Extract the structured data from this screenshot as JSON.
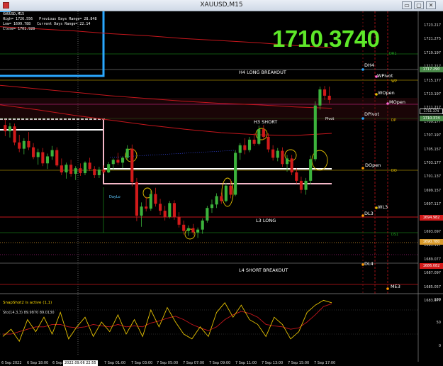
{
  "window": {
    "title": "XAUUSD,M15",
    "buttons": [
      "▭",
      "▢",
      "✕"
    ]
  },
  "info": {
    "line1": "XAUUSD,M15",
    "line2": "High= 1726.556   Previous Days Range= 28.848",
    "line3": "Low= 1699.788   Current Days Range= 22.14",
    "line4": "Close= 1701.928"
  },
  "big_price": "1710.3740",
  "colors": {
    "bg": "#000000",
    "up_candle": "#3cb33c",
    "down_candle": "#d11a1a",
    "big_price": "#5ee829",
    "bid_tag": "#4a8a4a",
    "ask_tag": "#d11a1a"
  },
  "levels": [
    {
      "name": "DR1",
      "text": "DR1",
      "color": "#1fa51f"
    },
    {
      "name": "DH4",
      "text": "DH4",
      "color": "#ffffff"
    },
    {
      "name": "H4 LONG BREAKOUT",
      "text": "H4 LONG BREAKOUT",
      "color": "#ffffff"
    },
    {
      "name": "WPivot",
      "text": "WPivot",
      "color": "#ffffff"
    },
    {
      "name": "WP",
      "text": "WP",
      "color": "#e6c200"
    },
    {
      "name": "WOpen",
      "text": "WOpen",
      "color": "#ffffff"
    },
    {
      "name": "MOpen",
      "text": "MOpen",
      "color": "#ffffff"
    },
    {
      "name": "DPivot",
      "text": "DPivot",
      "color": "#ffffff"
    },
    {
      "name": "H3 SHORT",
      "text": "H3 SHORT",
      "color": "#ffffff"
    },
    {
      "name": "Pivot",
      "text": "Pivot",
      "color": "#ffffff"
    },
    {
      "name": "DP",
      "text": "DP",
      "color": "#e6c200"
    },
    {
      "name": "DOpen",
      "text": "DOpen",
      "color": "#ffffff"
    },
    {
      "name": "DO",
      "text": "DO",
      "color": "#e6c200"
    },
    {
      "name": "WL3",
      "text": "WL3",
      "color": "#ffffff"
    },
    {
      "name": "DL3",
      "text": "DL3",
      "color": "#ffffff"
    },
    {
      "name": "L3 LONG",
      "text": "L3 LONG",
      "color": "#ffffff"
    },
    {
      "name": "DS1",
      "text": "DS1",
      "color": "#1fa51f"
    },
    {
      "name": "DL4",
      "text": "DL4",
      "color": "#ffffff"
    },
    {
      "name": "L4 SHORT BREAKOUT",
      "text": "L4 SHORT BREAKOUT",
      "color": "#ffffff"
    },
    {
      "name": "ME3",
      "text": "ME3",
      "color": "#ffffff"
    }
  ],
  "day_lo_label": "DayLo",
  "price_axis": [
    "1723.217",
    "1721.275",
    "1719.197",
    "1717.217",
    "1715.177",
    "1713.197",
    "1711.217",
    "1709.177",
    "1707.197",
    "1705.157",
    "1703.177",
    "1701.137",
    "1699.157",
    "1697.117",
    "1695.137",
    "1693.097",
    "1691.117",
    "1689.077",
    "1687.097",
    "1685.057",
    "1683.077"
  ],
  "price_tags": [
    {
      "value": "1717.290",
      "kind": "bid"
    },
    {
      "value": "1711.374",
      "kind": "plain"
    },
    {
      "value": "1710.374",
      "kind": "bid"
    },
    {
      "value": "1694.982",
      "kind": "ask"
    },
    {
      "value": "1690.780",
      "kind": "orange"
    },
    {
      "value": "1686.082",
      "kind": "ask"
    }
  ],
  "indicator": {
    "snapshot_text": "SnapShot2 is active (1,1)",
    "stoch_label": "Sto(14,3,3) 89.9870 89.0130",
    "levels": [
      "100",
      "50",
      "0"
    ]
  },
  "time_axis": [
    "6 Sep 2022",
    "6 Sep 18:00",
    "6 Sep",
    "7 Sep 01:00",
    "7 Sep 03:00",
    "7 Sep 05:00",
    "7 Sep 07:00",
    "7 Sep 09:00",
    "7 Sep 11:00",
    "7 Sep 13:00",
    "7 Sep 15:00",
    "7 Sep 17:00"
  ],
  "time_highlight": "2022.09.06 22:55",
  "chart_data": {
    "type": "candlestick",
    "symbol": "XAUUSD",
    "timeframe": "M15",
    "ylim": [
      1683.0,
      1724.0
    ],
    "candles": [
      [
        1707.8,
        1708.6,
        1706.2,
        1706.9
      ],
      [
        1706.9,
        1708.1,
        1706.0,
        1707.6
      ],
      [
        1707.6,
        1708.0,
        1704.9,
        1705.3
      ],
      [
        1705.3,
        1706.4,
        1703.9,
        1704.4
      ],
      [
        1704.4,
        1705.9,
        1703.6,
        1705.5
      ],
      [
        1705.5,
        1706.8,
        1704.2,
        1704.6
      ],
      [
        1704.6,
        1705.2,
        1702.9,
        1703.2
      ],
      [
        1703.2,
        1704.4,
        1702.1,
        1703.9
      ],
      [
        1703.9,
        1704.5,
        1701.9,
        1702.3
      ],
      [
        1702.3,
        1703.7,
        1701.5,
        1703.3
      ],
      [
        1703.3,
        1704.8,
        1702.8,
        1704.2
      ],
      [
        1704.2,
        1704.6,
        1701.8,
        1702.0
      ],
      [
        1702.0,
        1703.0,
        1700.6,
        1701.0
      ],
      [
        1701.0,
        1702.4,
        1700.1,
        1702.1
      ],
      [
        1702.1,
        1702.8,
        1700.4,
        1700.8
      ],
      [
        1700.8,
        1701.9,
        1699.9,
        1701.6
      ],
      [
        1701.6,
        1702.3,
        1700.5,
        1700.9
      ],
      [
        1700.9,
        1702.6,
        1700.6,
        1702.4
      ],
      [
        1702.4,
        1703.1,
        1701.2,
        1701.5
      ],
      [
        1701.5,
        1701.9,
        1700.2,
        1700.6
      ],
      [
        1700.6,
        1701.8,
        1700.2,
        1701.4
      ],
      [
        1701.4,
        1702.0,
        1700.8,
        1701.0
      ],
      [
        1701.0,
        1702.5,
        1700.9,
        1702.2
      ],
      [
        1702.2,
        1703.0,
        1701.3,
        1702.8
      ],
      [
        1702.8,
        1703.8,
        1702.1,
        1702.4
      ],
      [
        1702.4,
        1703.3,
        1701.6,
        1703.1
      ],
      [
        1703.1,
        1704.9,
        1702.7,
        1704.4
      ],
      [
        1704.4,
        1705.0,
        1699.0,
        1699.6
      ],
      [
        1699.6,
        1700.2,
        1694.0,
        1694.8
      ],
      [
        1694.8,
        1696.7,
        1693.2,
        1696.1
      ],
      [
        1696.1,
        1697.5,
        1695.4,
        1695.8
      ],
      [
        1695.8,
        1698.4,
        1695.5,
        1697.9
      ],
      [
        1697.9,
        1698.8,
        1696.1,
        1696.5
      ],
      [
        1696.5,
        1697.2,
        1694.9,
        1695.5
      ],
      [
        1695.5,
        1696.2,
        1694.1,
        1694.6
      ],
      [
        1694.6,
        1696.9,
        1694.4,
        1696.6
      ],
      [
        1696.6,
        1697.0,
        1694.2,
        1694.6
      ],
      [
        1694.6,
        1695.3,
        1693.1,
        1693.5
      ],
      [
        1693.5,
        1694.1,
        1692.1,
        1692.6
      ],
      [
        1692.6,
        1693.4,
        1691.9,
        1693.0
      ],
      [
        1693.0,
        1693.6,
        1692.0,
        1692.4
      ],
      [
        1692.4,
        1693.1,
        1691.6,
        1692.8
      ],
      [
        1692.8,
        1694.4,
        1692.2,
        1694.1
      ],
      [
        1694.1,
        1696.2,
        1693.8,
        1695.9
      ],
      [
        1695.9,
        1697.1,
        1695.2,
        1696.4
      ],
      [
        1696.4,
        1698.0,
        1695.9,
        1697.6
      ],
      [
        1697.6,
        1698.1,
        1696.5,
        1696.9
      ],
      [
        1696.9,
        1699.5,
        1696.7,
        1699.1
      ],
      [
        1699.1,
        1700.0,
        1697.3,
        1697.8
      ],
      [
        1697.8,
        1704.2,
        1697.6,
        1703.8
      ],
      [
        1703.8,
        1705.2,
        1702.8,
        1704.9
      ],
      [
        1704.9,
        1705.9,
        1703.6,
        1704.2
      ],
      [
        1704.2,
        1706.1,
        1703.9,
        1705.7
      ],
      [
        1705.7,
        1706.6,
        1704.8,
        1705.1
      ],
      [
        1705.1,
        1707.7,
        1704.9,
        1707.2
      ],
      [
        1707.2,
        1707.8,
        1705.7,
        1706.1
      ],
      [
        1706.1,
        1706.6,
        1703.9,
        1704.3
      ],
      [
        1704.3,
        1704.9,
        1702.7,
        1703.1
      ],
      [
        1703.1,
        1704.5,
        1702.6,
        1704.1
      ],
      [
        1704.1,
        1704.6,
        1701.8,
        1702.2
      ],
      [
        1702.2,
        1703.5,
        1701.1,
        1703.0
      ],
      [
        1703.0,
        1703.5,
        1700.6,
        1701.0
      ],
      [
        1701.0,
        1701.6,
        1699.4,
        1699.8
      ],
      [
        1699.8,
        1700.4,
        1698.0,
        1698.5
      ],
      [
        1698.5,
        1700.2,
        1697.8,
        1699.8
      ],
      [
        1699.8,
        1703.4,
        1699.3,
        1702.9
      ],
      [
        1702.9,
        1711.2,
        1702.6,
        1710.6
      ],
      [
        1710.6,
        1713.3,
        1710.0,
        1712.9
      ],
      [
        1712.9,
        1713.4,
        1711.4,
        1712.0
      ],
      [
        1712.0,
        1713.3,
        1710.9,
        1711.4
      ]
    ],
    "moving_averages": [
      {
        "color": "#c4161c",
        "values": [
          1721.9,
          1721.6,
          1721.3,
          1720.9,
          1720.6,
          1720.2,
          1719.9,
          1719.6,
          1719.2,
          1718.9
        ]
      },
      {
        "color": "#c4161c",
        "values": [
          1713.5,
          1713.0,
          1712.5,
          1712.0,
          1711.6,
          1711.2,
          1710.9,
          1710.7,
          1710.4,
          1710.2
        ]
      },
      {
        "color": "#c4161c",
        "values": [
          1710.7,
          1710.0,
          1709.2,
          1708.5,
          1707.8,
          1707.2,
          1706.7,
          1706.4,
          1706.3,
          1706.6
        ]
      }
    ]
  }
}
